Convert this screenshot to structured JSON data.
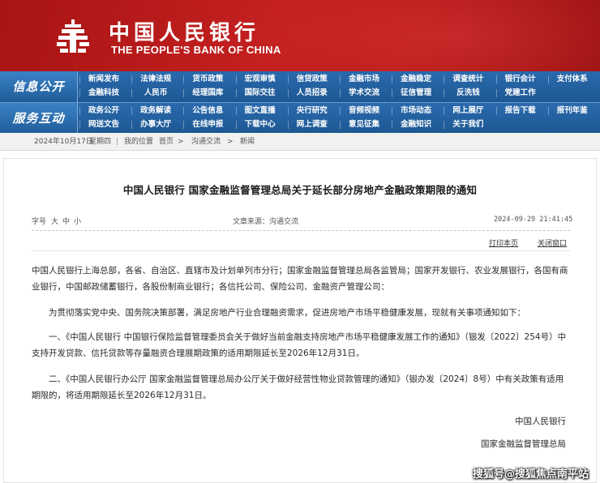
{
  "header": {
    "bank_name_cn": "中国人民银行",
    "bank_name_en": "THE PEOPLE'S BANK OF CHINA",
    "logo_icon": "pboc-emblem-icon",
    "brand_color": "#b01818"
  },
  "nav": {
    "section1_title": "信息公开",
    "section2_title": "服务互动",
    "row1": [
      "新闻发布",
      "法律法规",
      "货币政策",
      "宏观审慎",
      "信贷政策",
      "金融市场",
      "金融稳定",
      "调查统计",
      "银行会计",
      "支付体系"
    ],
    "row2": [
      "金融科技",
      "人民币",
      "经理国库",
      "国际交往",
      "人员招录",
      "学术交流",
      "征信管理",
      "反洗钱",
      "党建工作",
      ""
    ],
    "row3": [
      "政务公开",
      "政务解读",
      "公告信息",
      "图文直播",
      "央行研究",
      "音频视频",
      "市场动态",
      "网上展厅",
      "报告下载",
      "报刊年鉴"
    ],
    "row4": [
      "网送文告",
      "办事大厅",
      "在线申报",
      "下载中心",
      "网上调查",
      "意见征集",
      "金融知识",
      "关于我们",
      "",
      ""
    ],
    "nav_color": "#1e5c9a"
  },
  "breadcrumb": {
    "date": "2024年10月17日",
    "weekday": "星期四",
    "location_label": "我的位置",
    "home": "首页",
    "level1": "沟通交流",
    "level2": "新闻",
    "sep": ">"
  },
  "article": {
    "title": "中国人民银行 国家金融监督管理总局关于延长部分房地产金融政策期限的通知",
    "font_size_label": "字号",
    "font_size_options": [
      "大",
      "中",
      "小"
    ],
    "source": "文章来源：沟通交流",
    "datetime": "2024-09-29 21:41:45",
    "print_label": "打印本页",
    "close_label": "关闭窗口",
    "paragraphs": [
      "中国人民银行上海总部，各省、自治区、直辖市及计划单列市分行；国家金融监督管理总局各监管局；国家开发银行、农业发展银行，各国有商业银行，中国邮政储蓄银行，各股份制商业银行；各信托公司、保险公司、金融资产管理公司：",
      "为贯彻落实党中央、国务院决策部署，满足房地产行业合理融资需求，促进房地产市场平稳健康发展，现就有关事项通知如下：",
      "一、《中国人民银行 中国银行保险监督管理委员会关于做好当前金融支持房地产市场平稳健康发展工作的通知》（银发〔2022〕254号）中支持开发贷款、信托贷款等存量融资合理展期政策的适用期限延长至2026年12月31日。",
      "二、《中国人民银行办公厅 国家金融监督管理总局办公厅关于做好经营性物业贷款管理的通知》（银办发〔2024〕8号）中有关政策有适用期限的，将适用期限延长至2026年12月31日。"
    ],
    "signature1": "中国人民银行",
    "signature2": "国家金融监督管理总局"
  },
  "watermark": "搜狐号@搜狐焦点南平站"
}
